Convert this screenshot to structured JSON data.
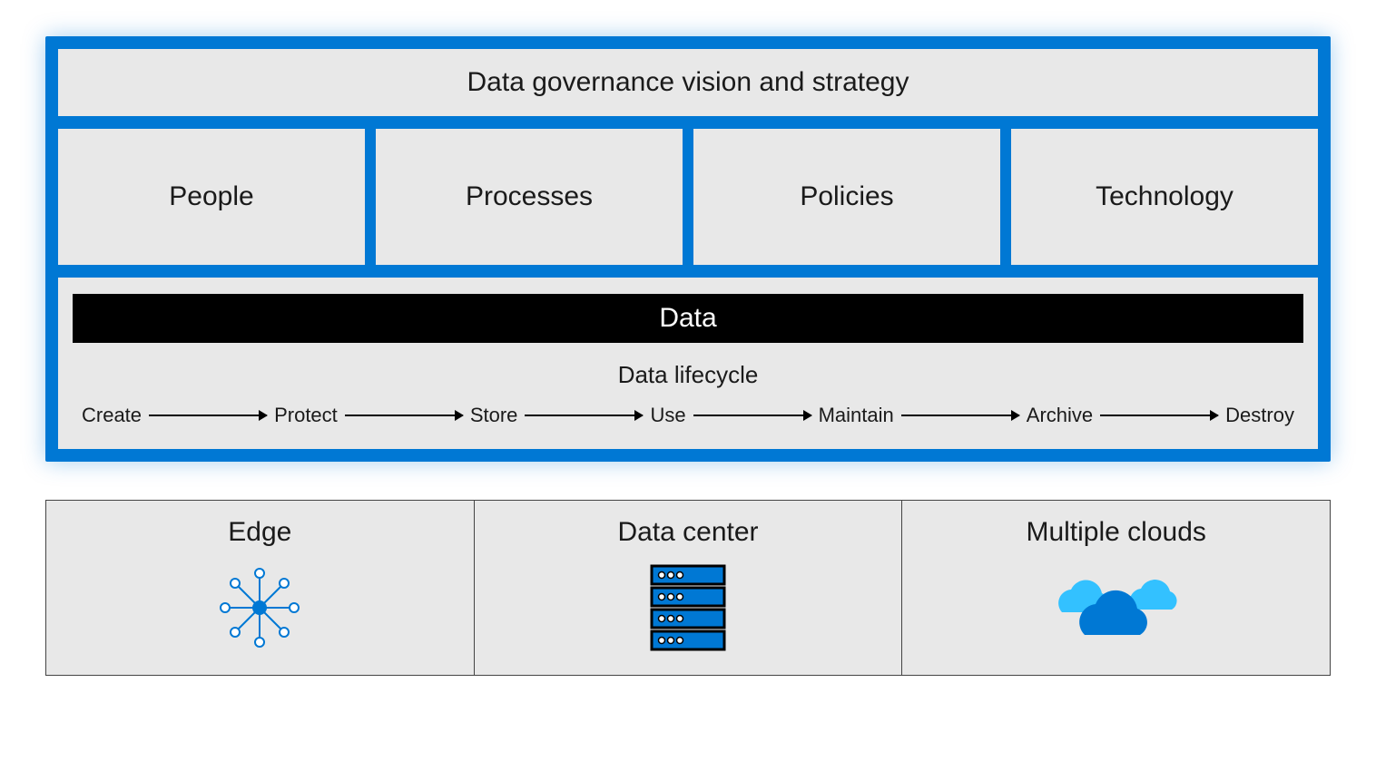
{
  "colors": {
    "framework_blue": "#0078d4",
    "panel_grey": "#e8e8e8",
    "data_band_bg": "#000000",
    "data_band_fg": "#ffffff",
    "icon_primary": "#0078d4",
    "icon_accent": "#33c1ff"
  },
  "vision": "Data governance vision and strategy",
  "pillars": [
    "People",
    "Processes",
    "Policies",
    "Technology"
  ],
  "data_band": "Data",
  "lifecycle_title": "Data lifecycle",
  "lifecycle_steps": [
    "Create",
    "Protect",
    "Store",
    "Use",
    "Maintain",
    "Archive",
    "Destroy"
  ],
  "environments": [
    {
      "label": "Edge",
      "icon": "edge-network-icon"
    },
    {
      "label": "Data center",
      "icon": "server-rack-icon"
    },
    {
      "label": "Multiple clouds",
      "icon": "clouds-icon"
    }
  ]
}
